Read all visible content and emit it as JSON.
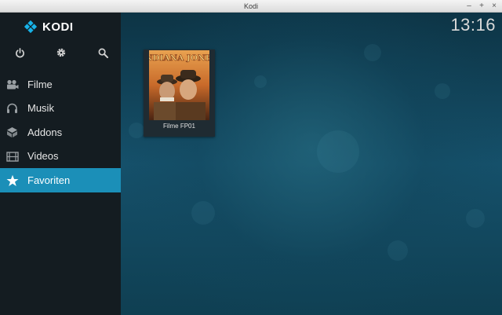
{
  "window": {
    "title": "Kodi",
    "controls": {
      "minimize": "–",
      "maximize": "+",
      "close": "×"
    }
  },
  "header": {
    "logo_text": "KODI",
    "clock": "13:16"
  },
  "sidebar": {
    "top_icons": [
      "power-icon",
      "gear-icon",
      "search-icon"
    ],
    "items": [
      {
        "label": "Filme",
        "icon": "film-icon",
        "active": false
      },
      {
        "label": "Musik",
        "icon": "headphones-icon",
        "active": false
      },
      {
        "label": "Addons",
        "icon": "box-icon",
        "active": false
      },
      {
        "label": "Videos",
        "icon": "video-icon",
        "active": false
      },
      {
        "label": "Favoriten",
        "icon": "star-icon",
        "active": true
      }
    ]
  },
  "main": {
    "favourites": [
      {
        "label": "Filme FP01",
        "poster_title": "INDIANA JONES"
      }
    ]
  },
  "colors": {
    "accent": "#1b8fb8",
    "sidebar": "#141c21",
    "background": "#123a4c"
  }
}
